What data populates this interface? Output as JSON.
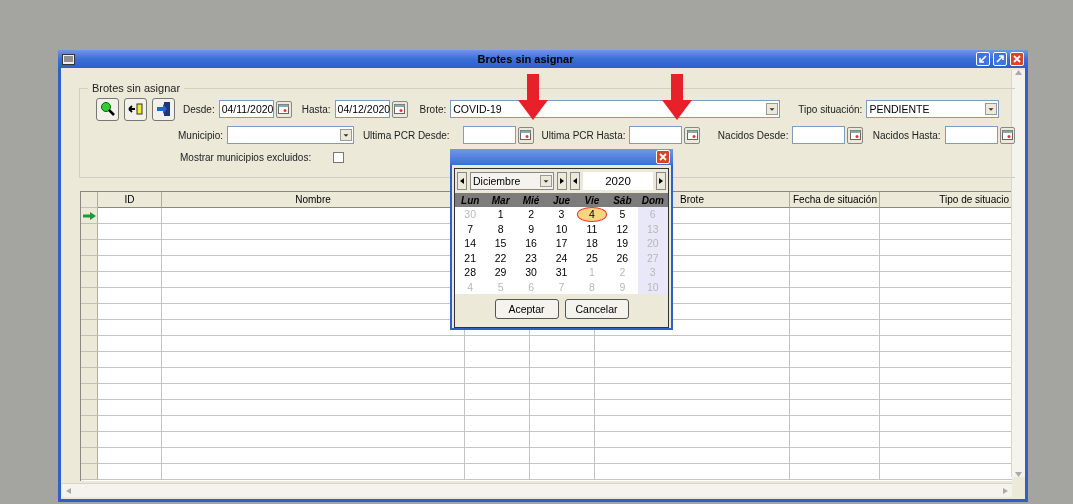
{
  "window": {
    "title": "Brotes sin asignar"
  },
  "filters": {
    "group_title": "Brotes sin asignar",
    "desde": {
      "label": "Desde:",
      "value": "04/11/2020"
    },
    "hasta": {
      "label": "Hasta:",
      "value": "04/12/2020"
    },
    "brote": {
      "label": "Brote:",
      "value": "COVID-19"
    },
    "tipo_situacion": {
      "label": "Tipo situación:",
      "value": "PENDIENTE"
    },
    "municipio": {
      "label": "Municipio:"
    },
    "ultima_pcr_desde": {
      "label": "Ultima PCR Desde:"
    },
    "ultima_pcr_hasta": {
      "label": "Ultima PCR Hasta:"
    },
    "nacidos_desde": {
      "label": "Nacidos Desde:"
    },
    "nacidos_hasta": {
      "label": "Nacidos Hasta:"
    },
    "mostrar_excluidos": {
      "label": "Mostrar municipios excluidos:",
      "checked": false
    }
  },
  "table": {
    "columns": [
      "ID",
      "Nombre",
      "Brote",
      "Fecha de situación",
      "Tipo de situacio"
    ],
    "rows": [
      {
        "current": true
      },
      {
        "current": false
      },
      {
        "current": false
      },
      {
        "current": false
      },
      {
        "current": false
      },
      {
        "current": false
      },
      {
        "current": false
      },
      {
        "current": false
      },
      {
        "current": false
      },
      {
        "current": false
      },
      {
        "current": false
      },
      {
        "current": false
      },
      {
        "current": false
      },
      {
        "current": false
      },
      {
        "current": false
      },
      {
        "current": false
      },
      {
        "current": false
      }
    ]
  },
  "calendar": {
    "month": "Diciembre",
    "year": "2020",
    "weekdays": [
      "Lun",
      "Mar",
      "Mié",
      "Jue",
      "Vie",
      "Sáb",
      "Dom"
    ],
    "weeks": [
      [
        {
          "day": "30",
          "muted": true,
          "selected": false
        },
        {
          "day": "1",
          "muted": false,
          "selected": false
        },
        {
          "day": "2",
          "muted": false,
          "selected": false
        },
        {
          "day": "3",
          "muted": false,
          "selected": false
        },
        {
          "day": "4",
          "muted": false,
          "selected": true
        },
        {
          "day": "5",
          "muted": false,
          "selected": false
        },
        {
          "day": "6",
          "muted": true,
          "selected": false
        }
      ],
      [
        {
          "day": "7",
          "muted": false,
          "selected": false
        },
        {
          "day": "8",
          "muted": false,
          "selected": false
        },
        {
          "day": "9",
          "muted": false,
          "selected": false
        },
        {
          "day": "10",
          "muted": false,
          "selected": false
        },
        {
          "day": "11",
          "muted": false,
          "selected": false
        },
        {
          "day": "12",
          "muted": false,
          "selected": false
        },
        {
          "day": "13",
          "muted": true,
          "selected": false
        }
      ],
      [
        {
          "day": "14",
          "muted": false,
          "selected": false
        },
        {
          "day": "15",
          "muted": false,
          "selected": false
        },
        {
          "day": "16",
          "muted": false,
          "selected": false
        },
        {
          "day": "17",
          "muted": false,
          "selected": false
        },
        {
          "day": "18",
          "muted": false,
          "selected": false
        },
        {
          "day": "19",
          "muted": false,
          "selected": false
        },
        {
          "day": "20",
          "muted": true,
          "selected": false
        }
      ],
      [
        {
          "day": "21",
          "muted": false,
          "selected": false
        },
        {
          "day": "22",
          "muted": false,
          "selected": false
        },
        {
          "day": "23",
          "muted": false,
          "selected": false
        },
        {
          "day": "24",
          "muted": false,
          "selected": false
        },
        {
          "day": "25",
          "muted": false,
          "selected": false
        },
        {
          "day": "26",
          "muted": false,
          "selected": false
        },
        {
          "day": "27",
          "muted": true,
          "selected": false
        }
      ],
      [
        {
          "day": "28",
          "muted": false,
          "selected": false
        },
        {
          "day": "29",
          "muted": false,
          "selected": false
        },
        {
          "day": "30",
          "muted": false,
          "selected": false
        },
        {
          "day": "31",
          "muted": false,
          "selected": false
        },
        {
          "day": "1",
          "muted": true,
          "selected": false
        },
        {
          "day": "2",
          "muted": true,
          "selected": false
        },
        {
          "day": "3",
          "muted": true,
          "selected": false
        }
      ],
      [
        {
          "day": "4",
          "muted": true,
          "selected": false
        },
        {
          "day": "5",
          "muted": true,
          "selected": false
        },
        {
          "day": "6",
          "muted": true,
          "selected": false
        },
        {
          "day": "7",
          "muted": true,
          "selected": false
        },
        {
          "day": "8",
          "muted": true,
          "selected": false
        },
        {
          "day": "9",
          "muted": true,
          "selected": false
        },
        {
          "day": "10",
          "muted": true,
          "selected": false
        }
      ]
    ],
    "buttons": [
      "Aceptar",
      "Cancelar"
    ]
  }
}
